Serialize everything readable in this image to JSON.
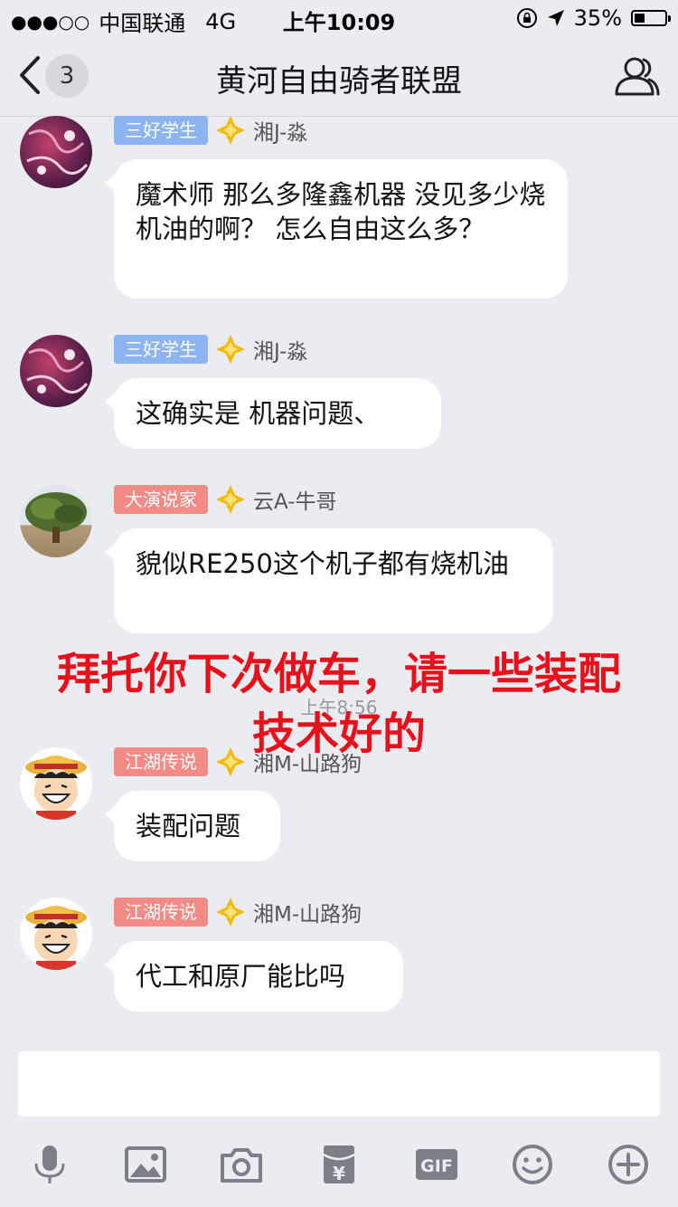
{
  "status_bar": {
    "signal": "●●●○○",
    "carrier": "中国联通",
    "network": "4G",
    "time": "上午10:09",
    "battery_percent": "35%",
    "battery_level": 0.35
  },
  "nav": {
    "unread_count": "3",
    "title": "黄河自由骑者联盟"
  },
  "messages": [
    {
      "badge": "三好学生",
      "badge_color": "#8cb4f0",
      "sender": "湘J-淼",
      "text": "魔术师 那么多隆鑫机器 没见多少烧机油的啊？ 怎么自由这么多？"
    },
    {
      "badge": "三好学生",
      "badge_color": "#8cb4f0",
      "sender": "湘J-淼",
      "text": "这确实是 机器问题、"
    },
    {
      "badge": "大演说家",
      "badge_color": "#f28b85",
      "sender": "云A-牛哥",
      "text": "貌似RE250这个机子都有烧机油"
    },
    {
      "badge": "江湖传说",
      "badge_color": "#f28b85",
      "sender": "湘M-山路狗",
      "text": "装配问题"
    },
    {
      "badge": "江湖传说",
      "badge_color": "#f28b85",
      "sender": "湘M-山路狗",
      "text": "代工和原厂能比吗"
    }
  ],
  "timestamp": "上午8:56",
  "overlay_caption": "拜托你下次做车，请一些装配技术好的",
  "toolbar": {
    "icons": [
      "microphone-icon",
      "image-icon",
      "camera-icon",
      "red-packet-icon",
      "gif-icon",
      "emoji-icon",
      "plus-icon"
    ],
    "gif_label": "GIF",
    "red_packet_label": "¥"
  },
  "colors": {
    "background": "#ebecf1",
    "bubble": "#ffffff",
    "icon_gray": "#7c7f87",
    "overlay_red": "#e8101a",
    "diamond_gold": "#f5b800"
  }
}
